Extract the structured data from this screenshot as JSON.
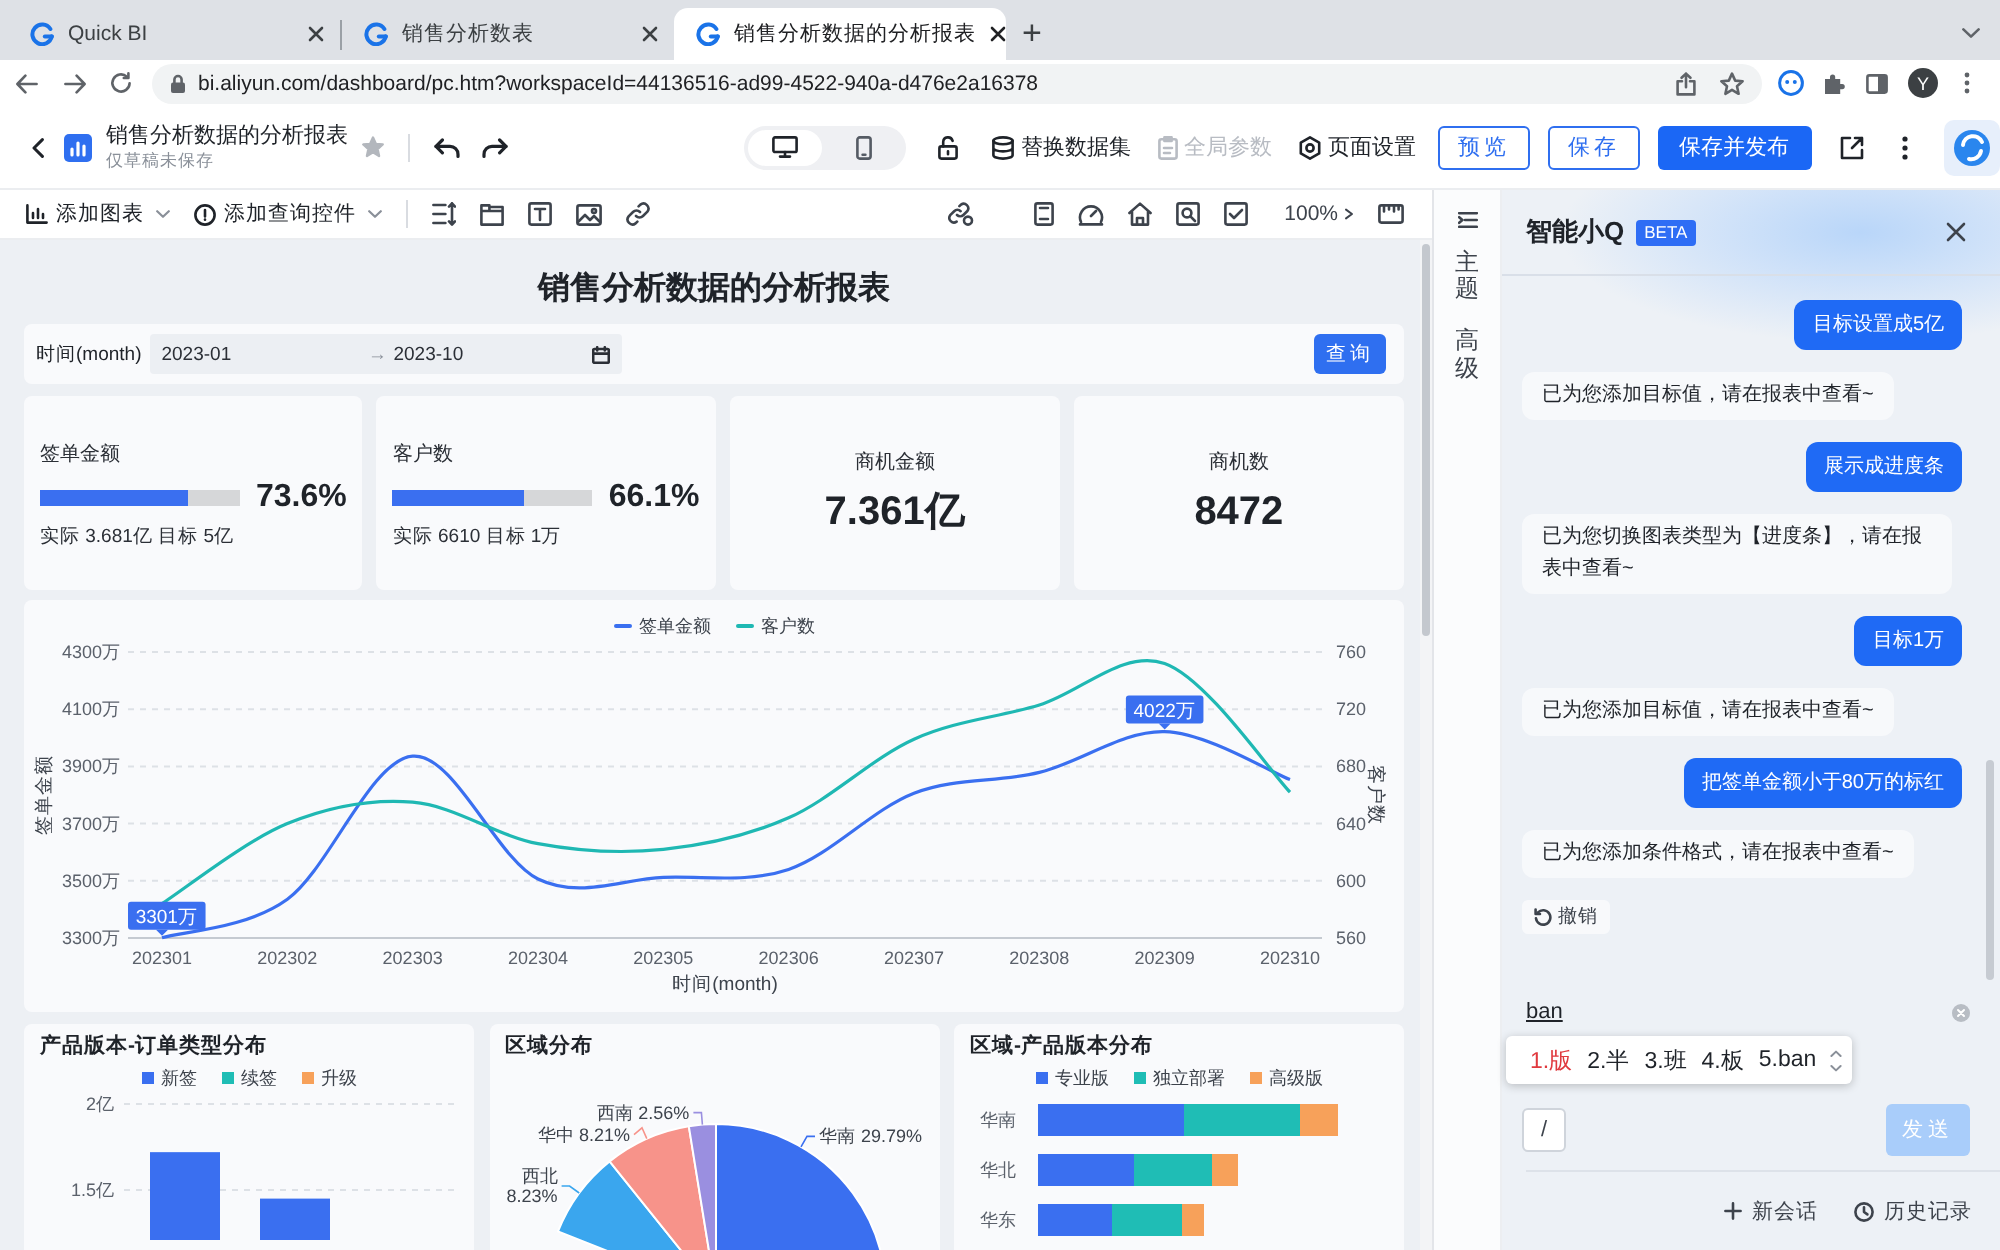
{
  "browser": {
    "tabs": [
      {
        "title": "Quick BI",
        "selected": false
      },
      {
        "title": "销售分析数表",
        "selected": false
      },
      {
        "title": "销售分析数据的分析报表",
        "selected": true
      }
    ],
    "new_tab": "+",
    "url": "bi.aliyun.com/dashboard/pc.htm?workspaceId=44136516-ad99-4522-940a-d476e2a16378",
    "profile": "Y"
  },
  "header": {
    "title": "销售分析数据的分析报表",
    "subtitle": "仅草稿未保存",
    "devices": [
      {
        "kind": "desktop",
        "selected": true
      },
      {
        "kind": "mobile",
        "selected": false
      }
    ],
    "actions": [
      {
        "kind": "dataset",
        "label": "替换数据集",
        "disabled": false
      },
      {
        "kind": "parameters",
        "label": "全局参数",
        "disabled": true
      },
      {
        "kind": "settings",
        "label": "页面设置",
        "disabled": false
      }
    ],
    "buttons": [
      {
        "kind": "outline",
        "label": "预览"
      },
      {
        "kind": "outline",
        "label": "保存"
      },
      {
        "kind": "primary",
        "label": "保存并发布"
      }
    ]
  },
  "toolbar": {
    "menus": [
      {
        "kind": "chart",
        "label": "添加图表"
      },
      {
        "kind": "query",
        "label": "添加查询控件"
      }
    ],
    "zoom": "100%"
  },
  "dashboard": {
    "title": "销售分析数据的分析报表",
    "filter": {
      "label": "时间(month)",
      "start": "2023-01",
      "separator": "→",
      "end": "2023-10",
      "button": "查询"
    },
    "kpis": [
      {
        "kind": "progress",
        "title": "签单金额",
        "level": 0.736,
        "percent": "73.6%",
        "detail": "实际 3.681亿 目标 5亿"
      },
      {
        "kind": "progress",
        "title": "客户数",
        "level": 0.661,
        "percent": "66.1%",
        "detail": "实际 6610 目标 1万"
      },
      {
        "kind": "value",
        "title": "商机金额",
        "value": "7.361亿"
      },
      {
        "kind": "value",
        "title": "商机数",
        "value": "8472"
      }
    ],
    "trend": {
      "chart_data": {
        "type": "line",
        "grid": true,
        "legend": "top",
        "xlabel": "时间(month)",
        "ylabel": "签单金额",
        "y2label": "客户数",
        "categories": [
          "202301",
          "202302",
          "202303",
          "202304",
          "202305",
          "202306",
          "202307",
          "202308",
          "202309",
          "202310"
        ],
        "ylim": [
          3300,
          4300
        ],
        "yticks": [
          {
            "value": 3300,
            "label": "3300万"
          },
          {
            "value": 3500,
            "label": "3500万"
          },
          {
            "value": 3700,
            "label": "3700万"
          },
          {
            "value": 3900,
            "label": "3900万"
          },
          {
            "value": 4100,
            "label": "4100万"
          },
          {
            "value": 4300,
            "label": "4300万"
          }
        ],
        "y2lim": [
          560,
          760
        ],
        "y2ticks": [
          560,
          600,
          640,
          680,
          720,
          760
        ],
        "series": [
          {
            "name": "签单金额",
            "color": "#3a6ff0",
            "values": [
              3301,
              3436,
              3936,
              3506,
              3512,
              3540,
              3806,
              3879,
              4022,
              3854
            ]
          },
          {
            "name": "客户数",
            "color": "#1fb8b3",
            "axis": "y2",
            "values": [
              584,
              640,
              655,
              626,
              622,
              644,
              699,
              723,
              752,
              662
            ]
          }
        ],
        "annotations": [
          {
            "x": "202301",
            "y": 3301,
            "text": "3301万"
          },
          {
            "x": "202309",
            "y": 4022,
            "text": "4022万"
          }
        ]
      }
    },
    "panels": [
      {
        "title": "产品版本-订单类型分布",
        "chart_data": {
          "type": "bar",
          "grid": true,
          "legend": "top",
          "ylim": [
            0,
            2
          ],
          "yticks": [
            {
              "value": 1.5,
              "label": "1.5亿"
            },
            {
              "value": 2,
              "label": "2亿"
            }
          ],
          "series": [
            {
              "name": "新签",
              "color": "#3a6ff0",
              "values": [
                1.72,
                1.45
              ]
            },
            {
              "name": "续签",
              "color": "#1fbdb5",
              "values": [
                null,
                null
              ]
            },
            {
              "name": "升级",
              "color": "#f7a15a",
              "values": [
                null,
                null
              ]
            }
          ]
        }
      },
      {
        "title": "区域分布",
        "chart_data": {
          "type": "pie",
          "categories": [
            "华南",
            "西北",
            "华中",
            "西南"
          ],
          "values": [
            29.79,
            8.23,
            8.21,
            2.56
          ],
          "colors": [
            "#3a6ff0",
            "#3aa6ee",
            "#f7938a",
            "#9a8fe0"
          ],
          "value_labels": [
            "29.79%",
            "8.23%",
            "8.21%",
            "2.56%"
          ]
        }
      },
      {
        "kind": "hbar",
        "title": "区域-产品版本分布",
        "legend": [
          {
            "name": "专业版",
            "color": "#3a6ff0"
          },
          {
            "name": "独立部署",
            "color": "#1fbdb5"
          },
          {
            "name": "高级版",
            "color": "#f7a15a"
          }
        ],
        "categories": [
          "华南",
          "华北",
          "华东"
        ]
      }
    ]
  },
  "assistant": {
    "side_tabs": [
      {
        "label": "主题"
      },
      {
        "label": "高级"
      }
    ],
    "title": "智能小Q",
    "badge": "BETA",
    "messages": [
      {
        "kind": "user",
        "text": "目标设置成5亿"
      },
      {
        "kind": "bot",
        "text": "已为您添加目标值，请在报表中查看~"
      },
      {
        "kind": "user",
        "text": "展示成进度条"
      },
      {
        "kind": "bot",
        "text": "已为您切换图表类型为【进度条】，请在报表中查看~"
      },
      {
        "kind": "user",
        "text": "目标1万"
      },
      {
        "kind": "bot",
        "text": "已为您添加目标值，请在报表中查看~"
      },
      {
        "kind": "user",
        "text": "把签单金额小于80万的标红"
      },
      {
        "kind": "bot",
        "text": "已为您添加条件格式，请在报表中查看~"
      }
    ],
    "undo": "撤销",
    "input": {
      "value": "ban"
    },
    "ime": [
      {
        "label": "1.版",
        "selected": true
      },
      {
        "label": "2.半",
        "selected": false
      },
      {
        "label": "3.班",
        "selected": false
      },
      {
        "label": "4.板",
        "selected": false
      },
      {
        "label": "5.ban",
        "selected": false
      }
    ],
    "command": "/",
    "send": {
      "label": "发送",
      "disabled": true
    },
    "footer": [
      {
        "kind": "new",
        "label": "新会话"
      },
      {
        "kind": "history",
        "label": "历史记录"
      }
    ]
  }
}
